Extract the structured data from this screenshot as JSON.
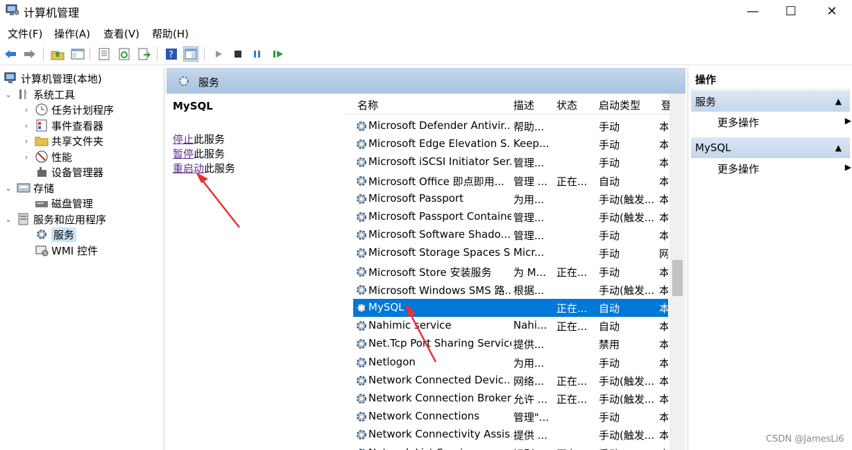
{
  "window": {
    "title": "计算机管理",
    "minimize": "—",
    "maximize": "☐",
    "close": "✕"
  },
  "menu": [
    "文件(F)",
    "操作(A)",
    "查看(V)",
    "帮助(H)"
  ],
  "tree": {
    "root": "计算机管理(本地)",
    "items": [
      "系统工具",
      "任务计划程序",
      "事件查看器",
      "共享文件夹",
      "性能",
      "设备管理器",
      "存储",
      "磁盘管理",
      "服务和应用程序",
      "服务",
      "WMI 控件"
    ]
  },
  "center": {
    "header": "服务",
    "selected_service": "MySQL",
    "actions": [
      {
        "link": "停止",
        "suffix": "此服务"
      },
      {
        "link": "暂停",
        "suffix": "此服务"
      },
      {
        "link": "重启动",
        "suffix": "此服务"
      }
    ]
  },
  "columns": [
    "名称",
    "描述",
    "状态",
    "启动类型",
    "登"
  ],
  "services": [
    {
      "name": "Microsoft Defender Antivir...",
      "desc": "帮助...",
      "status": "",
      "startup": "手动",
      "logon": "本"
    },
    {
      "name": "Microsoft Edge Elevation S...",
      "desc": "Keep...",
      "status": "",
      "startup": "手动",
      "logon": "本"
    },
    {
      "name": "Microsoft iSCSI Initiator Ser...",
      "desc": "管理...",
      "status": "",
      "startup": "手动",
      "logon": "本"
    },
    {
      "name": "Microsoft Office 即点即用...",
      "desc": "管理 ...",
      "status": "正在...",
      "startup": "自动",
      "logon": "本"
    },
    {
      "name": "Microsoft Passport",
      "desc": "为用...",
      "status": "",
      "startup": "手动(触发...",
      "logon": "本"
    },
    {
      "name": "Microsoft Passport Container",
      "desc": "管理...",
      "status": "",
      "startup": "手动(触发...",
      "logon": "本"
    },
    {
      "name": "Microsoft Software Shado...",
      "desc": "管理...",
      "status": "",
      "startup": "手动",
      "logon": "本"
    },
    {
      "name": "Microsoft Storage Spaces S...",
      "desc": "Micr...",
      "status": "",
      "startup": "手动",
      "logon": "网"
    },
    {
      "name": "Microsoft Store 安装服务",
      "desc": "为 M...",
      "status": "正在...",
      "startup": "手动",
      "logon": "本"
    },
    {
      "name": "Microsoft Windows SMS 路...",
      "desc": "根据...",
      "status": "",
      "startup": "手动(触发...",
      "logon": "本"
    },
    {
      "name": "MySQL",
      "desc": "",
      "status": "正在...",
      "startup": "自动",
      "logon": "本"
    },
    {
      "name": "Nahimic service",
      "desc": "Nahi...",
      "status": "正在...",
      "startup": "自动",
      "logon": "本"
    },
    {
      "name": "Net.Tcp Port Sharing Service",
      "desc": "提供...",
      "status": "",
      "startup": "禁用",
      "logon": "本"
    },
    {
      "name": "Netlogon",
      "desc": "为用...",
      "status": "",
      "startup": "手动",
      "logon": "本"
    },
    {
      "name": "Network Connected Devic...",
      "desc": "网络...",
      "status": "正在...",
      "startup": "手动(触发...",
      "logon": "本"
    },
    {
      "name": "Network Connection Broker",
      "desc": "允许 ...",
      "status": "正在...",
      "startup": "手动(触发...",
      "logon": "本"
    },
    {
      "name": "Network Connections",
      "desc": "管理\"...",
      "status": "",
      "startup": "手动",
      "logon": "本"
    },
    {
      "name": "Network Connectivity Assis...",
      "desc": "提供 ...",
      "status": "",
      "startup": "手动(触发...",
      "logon": "本"
    },
    {
      "name": "Network List Service",
      "desc": "识别...",
      "status": "正在...",
      "startup": "手动",
      "logon": "本"
    }
  ],
  "selected_index": 10,
  "right": {
    "title": "操作",
    "sections": [
      {
        "header": "服务",
        "item": "更多操作"
      },
      {
        "header": "MySQL",
        "item": "更多操作"
      }
    ]
  },
  "watermark": "CSDN @JamesLi6",
  "colors": {
    "selection": "#0078d7",
    "link": "#5b2d91",
    "arrow": "#e8312f"
  }
}
